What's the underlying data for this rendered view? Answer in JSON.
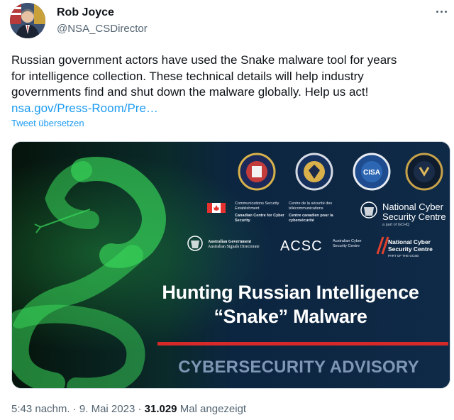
{
  "author": {
    "name": "Rob Joyce",
    "handle": "@NSA_CSDirector"
  },
  "tweet": {
    "lines": [
      "Russian government actors have used the Snake malware tool for years",
      "for intelligence collection. These technical details will help industry",
      "governments find and shut down the malware globally.  Help us act!"
    ],
    "link": "nsa.gov/Press-Room/Pre…",
    "translate_label": "Tweet übersetzen"
  },
  "media": {
    "headline_line1": "Hunting Russian Intelligence",
    "headline_line2": "“Snake” Malware",
    "advisory": "CYBERSECURITY ADVISORY",
    "cse_en": "Communications Security Establishment",
    "cse_fr": "Centre de la sécurité des télécommunications",
    "cccs_en": "Canadian Centre for Cyber Security",
    "cccs_fr": "Centre canadien pour la cybersécurité",
    "ncsc_name": "National Cyber Security Centre",
    "ncsc_sub": "a part of GCHQ",
    "aus_gov": "Australian Government",
    "asd": "Australian Signals Directorate",
    "acsc": "ACSC",
    "acsc_sub": "Australian Cyber Security Centre",
    "ncsc_nz": "National Cyber Security Centre",
    "ncsc_nz_sub": "PART OF THE GCSB",
    "colors": {
      "background": "#0b1f33",
      "snake": "#39d85a",
      "red_bar": "#d62a2a",
      "advisory_text": "#7f97b5"
    }
  },
  "footer": {
    "time": "5:43 nachm.",
    "separator": "·",
    "date": "9. Mai 2023",
    "views_count": "31.029",
    "views_label": "Mal angezeigt"
  },
  "icons": {
    "avatar": "avatar",
    "more": "more-options-icon"
  }
}
